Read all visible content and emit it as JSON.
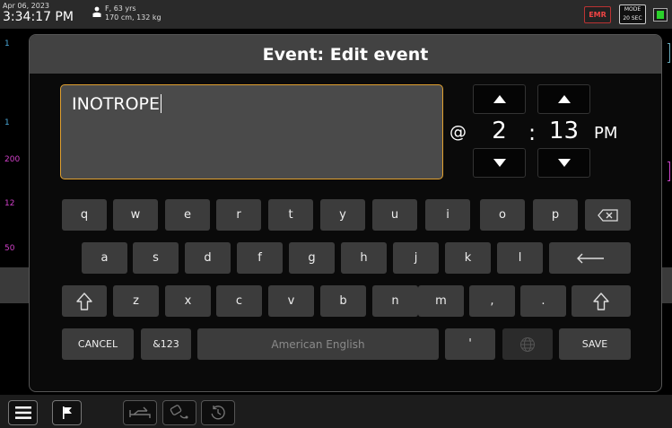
{
  "status": {
    "date": "Apr 06, 2023",
    "time": "3:34:17 PM",
    "patient_summary": "F, 63 yrs",
    "patient_body": "170 cm, 132 kg",
    "emr_label": "EMR",
    "mode_label": "MODE",
    "mode_value": "20 SEC"
  },
  "background": {
    "values": [
      "1",
      "1",
      "200",
      "12",
      "50"
    ]
  },
  "dialog": {
    "title": "Event: Edit event",
    "event_text": "INOTROPE",
    "at_symbol": "@",
    "hour": "2",
    "separator": ":",
    "minute": "13",
    "ampm": "PM"
  },
  "keyboard": {
    "row1": [
      "q",
      "w",
      "e",
      "r",
      "t",
      "y",
      "u",
      "i",
      "o",
      "p"
    ],
    "row2": [
      "a",
      "s",
      "d",
      "f",
      "g",
      "h",
      "j",
      "k",
      "l"
    ],
    "row3": [
      "z",
      "x",
      "c",
      "v",
      "b",
      "n",
      "m",
      ",",
      "."
    ],
    "cancel": "CANCEL",
    "symbols": "&123",
    "space": "American English",
    "apostrophe": "'",
    "save": "SAVE"
  },
  "colors": {
    "accent_border": "#e0a030",
    "emr_red": "#e44",
    "battery_green": "#2bd12b"
  },
  "icons": [
    "user-icon",
    "backspace-icon",
    "enter-icon",
    "shift-icon",
    "globe-icon",
    "menu-icon",
    "flag-icon",
    "bed-icon",
    "pump-icon",
    "history-icon"
  ]
}
